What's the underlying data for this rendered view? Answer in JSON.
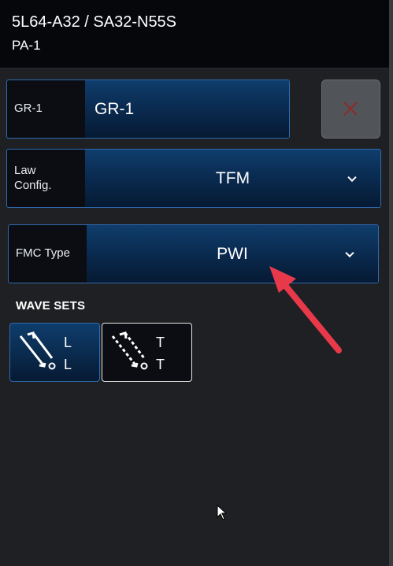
{
  "header": {
    "title": "5L64-A32 / SA32-N55S",
    "subtitle": "PA-1"
  },
  "group": {
    "label": "GR-1",
    "value": "GR-1"
  },
  "law_config": {
    "label_line1": "Law",
    "label_line2": "Config.",
    "value": "TFM"
  },
  "fmc_type": {
    "label": "FMC Type",
    "value": "PWI"
  },
  "wave_sets": {
    "heading": "WAVE SETS",
    "items": [
      {
        "line1": "L",
        "line2": "L",
        "selected": true,
        "icon": "wave-ll-icon"
      },
      {
        "line1": "T",
        "line2": "T",
        "selected": false,
        "icon": "wave-tt-icon"
      }
    ]
  },
  "colors": {
    "accent": "#2f6bb0",
    "field_fill": "#0a2c52",
    "close_x": "#8b2b2b",
    "annotation_arrow": "#e8394a"
  }
}
